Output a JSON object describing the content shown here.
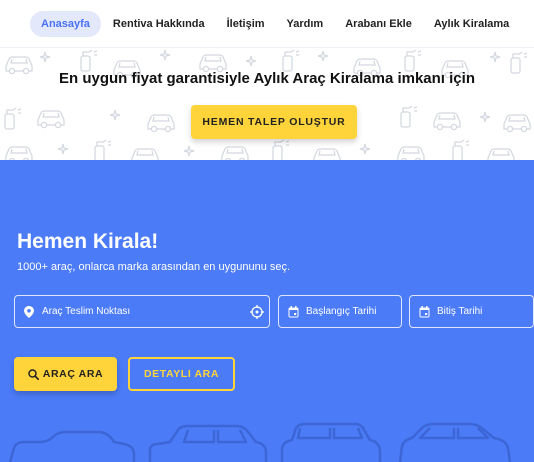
{
  "nav": {
    "items": [
      {
        "label": "Anasayfa",
        "active": true
      },
      {
        "label": "Rentiva Hakkında"
      },
      {
        "label": "İletişim"
      },
      {
        "label": "Yardım"
      },
      {
        "label": "Arabanı Ekle"
      },
      {
        "label": "Aylık Kiralama"
      }
    ]
  },
  "promo": {
    "text": "En uygun fiyat garantisiyle Aylık Araç Kiralama imkanı için",
    "button_label": "HEMEN TALEP OLUŞTUR"
  },
  "hero": {
    "title": "Hemen Kirala!",
    "subtitle": "1000+ araç, onlarca marka arasından en uygununu seç.",
    "location_placeholder": "Araç Teslim Noktası",
    "start_date_placeholder": "Başlangıç Tarihi",
    "end_date_placeholder": "Bitiş Tarihi",
    "search_label": "ARAÇ ARA",
    "detail_label": "DETAYLI ARA"
  },
  "colors": {
    "accent": "#4b7bf7",
    "button": "#ffd43b",
    "nav_active_bg": "#e3e8fb",
    "nav_active_text": "#4a72f5"
  },
  "icons": [
    "location-pin-icon",
    "crosshair-icon",
    "calendar-icon",
    "search-icon"
  ]
}
